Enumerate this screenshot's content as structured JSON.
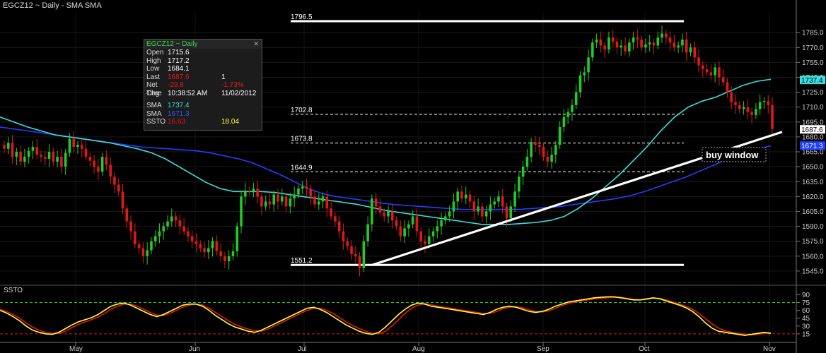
{
  "header": {
    "title": "EGCZ12 ~ Daily  -  SMA SMA"
  },
  "info_box": {
    "title": "EGCZ12 ~ Daily",
    "rows": [
      {
        "label": "Open",
        "value": "1715.6",
        "extra": ""
      },
      {
        "label": "High",
        "value": "1717.2",
        "extra": ""
      },
      {
        "label": "Low",
        "value": "1684.1",
        "extra": ""
      },
      {
        "label": "Last",
        "value": "1687.6",
        "extra": "1"
      },
      {
        "label": "Net Chg",
        "value": "-29.8",
        "extra": "-1.73%"
      },
      {
        "label": "Time",
        "value": "10:38:52 AM",
        "extra": "11/02/2012"
      }
    ],
    "indicators": [
      {
        "label": "SMA",
        "value": "1737.4",
        "extra": "",
        "color": "cyan"
      },
      {
        "label": "SMA",
        "value": "1671.3",
        "extra": "",
        "color": "blue"
      },
      {
        "label": "SSTO",
        "value": "16.63",
        "extra": "18.04",
        "color": "red"
      }
    ]
  },
  "price_tags": [
    {
      "value": "1737.4",
      "bg": "#38e0e0",
      "fg": "#000000"
    },
    {
      "value": "1687.6",
      "bg": "#ffffff",
      "fg": "#000000"
    },
    {
      "value": "1671.3",
      "bg": "#2040ff",
      "fg": "#ffffff"
    }
  ],
  "annotation": "buy window",
  "lower_panel": {
    "title": "SSTO"
  },
  "colors": {
    "up": "#22cc22",
    "down": "#e01818",
    "sma_fast": "#38e0e0",
    "sma_slow": "#2040ff",
    "ssto_k": "#ffff33",
    "ssto_d": "#e01818",
    "ssto_ob": "#22cc22",
    "ssto_os": "#e01818"
  },
  "chart_data": [
    {
      "type": "candlestick",
      "title": "EGCZ12 ~ Daily  -  SMA SMA",
      "ylim": [
        1535,
        1805
      ],
      "yticks": [
        1785.0,
        1770.0,
        1755.0,
        1740.0,
        1725.0,
        1710.0,
        1695.0,
        1680.0,
        1665.0,
        1650.0,
        1635.0,
        1620.0,
        1605.0,
        1590.0,
        1575.0,
        1560.0,
        1545.0
      ],
      "months": [
        "May",
        "Jun",
        "Jul",
        "Aug",
        "Sep",
        "Oct",
        "Nov"
      ],
      "close": [
        1668,
        1674,
        1660,
        1665,
        1655,
        1660,
        1666,
        1670,
        1662,
        1660,
        1658,
        1665,
        1655,
        1660,
        1650,
        1664,
        1678,
        1670,
        1672,
        1668,
        1660,
        1656,
        1650,
        1645,
        1660,
        1652,
        1640,
        1632,
        1625,
        1608,
        1595,
        1585,
        1572,
        1568,
        1560,
        1566,
        1575,
        1580,
        1585,
        1590,
        1595,
        1600,
        1596,
        1590,
        1585,
        1580,
        1575,
        1572,
        1568,
        1564,
        1568,
        1575,
        1565,
        1560,
        1555,
        1560,
        1565,
        1590,
        1620,
        1626,
        1625,
        1628,
        1620,
        1610,
        1615,
        1612,
        1622,
        1615,
        1620,
        1610,
        1618,
        1622,
        1628,
        1630,
        1628,
        1620,
        1612,
        1615,
        1620,
        1608,
        1600,
        1595,
        1585,
        1575,
        1570,
        1562,
        1560,
        1548,
        1575,
        1592,
        1618,
        1610,
        1604,
        1600,
        1605,
        1596,
        1590,
        1580,
        1588,
        1592,
        1600,
        1585,
        1575,
        1572,
        1580,
        1585,
        1590,
        1596,
        1600,
        1605,
        1615,
        1625,
        1618,
        1622,
        1615,
        1605,
        1610,
        1600,
        1605,
        1612,
        1615,
        1620,
        1610,
        1598,
        1610,
        1625,
        1640,
        1650,
        1660,
        1675,
        1672,
        1670,
        1660,
        1655,
        1662,
        1672,
        1690,
        1700,
        1705,
        1712,
        1725,
        1742,
        1745,
        1760,
        1775,
        1778,
        1772,
        1768,
        1780,
        1776,
        1770,
        1772,
        1766,
        1775,
        1780,
        1778,
        1770,
        1773,
        1775,
        1772,
        1780,
        1784,
        1780,
        1775,
        1770,
        1772,
        1778,
        1765,
        1770,
        1760,
        1752,
        1748,
        1745,
        1742,
        1750,
        1740,
        1735,
        1725,
        1715,
        1712,
        1708,
        1710,
        1705,
        1702,
        1708,
        1715,
        1716,
        1712,
        1688
      ],
      "sma_fast": [
        1700,
        1695,
        1690,
        1686,
        1682,
        1680,
        1678,
        1676,
        1674,
        1671,
        1668,
        1664,
        1658,
        1650,
        1642,
        1634,
        1628,
        1625,
        1625,
        1625,
        1624,
        1622,
        1620,
        1618,
        1616,
        1614,
        1612,
        1609,
        1606,
        1604,
        1602,
        1600,
        1598,
        1596,
        1594,
        1592,
        1592,
        1592,
        1593,
        1594,
        1596,
        1600,
        1608,
        1618,
        1630,
        1642,
        1656,
        1670,
        1686,
        1700,
        1710,
        1716,
        1720,
        1726,
        1732,
        1736,
        1738
      ],
      "sma_slow": [
        1690,
        1688,
        1686,
        1684,
        1682,
        1680,
        1678,
        1676,
        1674,
        1672,
        1670,
        1669,
        1668,
        1667,
        1666,
        1664,
        1661,
        1658,
        1654,
        1648,
        1642,
        1635,
        1628,
        1623,
        1620,
        1618,
        1616,
        1614,
        1612,
        1611,
        1610,
        1609,
        1608,
        1607,
        1607,
        1607,
        1607,
        1607,
        1608,
        1609,
        1610,
        1612,
        1614,
        1616,
        1618,
        1621,
        1625,
        1630,
        1635,
        1640,
        1646,
        1652,
        1658,
        1663,
        1668,
        1671
      ],
      "horizontal_lines": [
        1796.5,
        1702.8,
        1673.8,
        1644.9,
        1551.2
      ],
      "horizontal_labels": [
        "1796.5",
        "1702.8",
        "1673.8",
        "1644.9",
        "1551.2"
      ],
      "trendline": {
        "from": [
          91,
          1551
        ],
        "to": [
          200,
          1685
        ]
      }
    },
    {
      "type": "line",
      "title": "SSTO",
      "ylim": [
        0,
        100
      ],
      "yticks": [
        90,
        75,
        60,
        45,
        30,
        15
      ],
      "levels": [
        75,
        15
      ],
      "k": [
        60,
        55,
        48,
        40,
        30,
        22,
        18,
        15,
        14,
        18,
        25,
        32,
        38,
        42,
        46,
        52,
        60,
        68,
        72,
        74,
        70,
        64,
        58,
        52,
        48,
        52,
        58,
        64,
        70,
        72,
        72,
        68,
        60,
        50,
        42,
        34,
        28,
        24,
        20,
        18,
        22,
        28,
        34,
        40,
        46,
        52,
        58,
        64,
        66,
        62,
        56,
        48,
        40,
        32,
        26,
        20,
        16,
        14,
        18,
        28,
        40,
        52,
        62,
        70,
        74,
        72,
        68,
        66,
        64,
        62,
        60,
        58,
        56,
        54,
        52,
        56,
        62,
        66,
        68,
        66,
        62,
        58,
        56,
        58,
        62,
        68,
        72,
        76,
        78,
        80,
        82,
        84,
        85,
        86,
        86,
        84,
        82,
        80,
        80,
        82,
        84,
        82,
        78,
        74,
        70,
        65,
        58,
        48,
        36,
        26,
        20,
        18,
        16,
        14,
        12,
        14,
        16,
        18,
        16
      ],
      "d": [
        62,
        58,
        52,
        45,
        36,
        28,
        22,
        18,
        16,
        16,
        20,
        27,
        33,
        38,
        42,
        47,
        54,
        62,
        68,
        72,
        72,
        68,
        62,
        56,
        51,
        50,
        54,
        60,
        66,
        70,
        72,
        70,
        64,
        56,
        48,
        40,
        33,
        28,
        24,
        21,
        20,
        24,
        30,
        36,
        42,
        48,
        54,
        60,
        64,
        64,
        60,
        54,
        46,
        38,
        31,
        25,
        20,
        16,
        15,
        20,
        30,
        42,
        54,
        64,
        70,
        73,
        71,
        68,
        66,
        64,
        62,
        60,
        58,
        56,
        54,
        54,
        58,
        63,
        66,
        67,
        65,
        61,
        58,
        57,
        59,
        64,
        69,
        73,
        76,
        78,
        80,
        82,
        83,
        84,
        85,
        85,
        83,
        81,
        80,
        81,
        83,
        83,
        80,
        76,
        72,
        68,
        62,
        54,
        44,
        34,
        26,
        21,
        18,
        16,
        14,
        13,
        14,
        16,
        17
      ]
    }
  ]
}
